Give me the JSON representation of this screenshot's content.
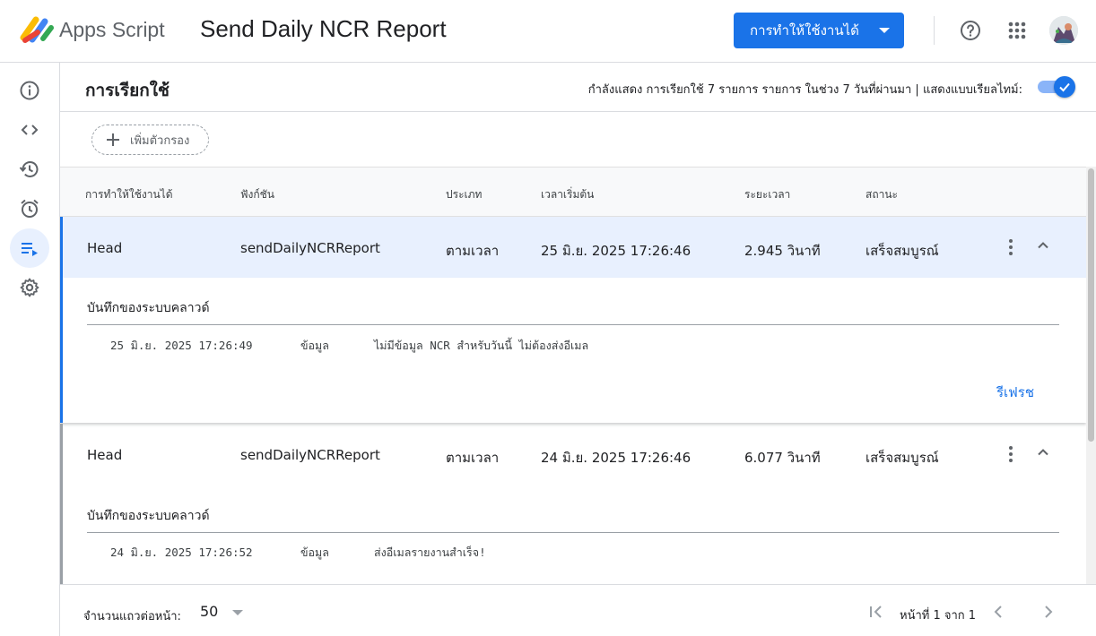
{
  "app": {
    "brand": "Apps Script",
    "project_title": "Send Daily NCR Report"
  },
  "topbar": {
    "deploy_label": "การทำให้ใช้งานได้"
  },
  "nav": {
    "items": [
      {
        "icon": "info-icon"
      },
      {
        "icon": "code-icon"
      },
      {
        "icon": "history-icon"
      },
      {
        "icon": "alarm-icon"
      },
      {
        "icon": "executions-icon",
        "active": true
      },
      {
        "icon": "gear-icon"
      }
    ]
  },
  "header": {
    "title": "การเรียกใช้",
    "summary": "กำลังแสดง การเรียกใช้ 7 รายการ รายการ ในช่วง 7 วันที่ผ่านมา  |  แสดงแบบเรียลไทม์:",
    "realtime_on": true
  },
  "filter": {
    "add_label": "เพิ่มตัวกรอง"
  },
  "table": {
    "columns": [
      "การทำให้ใช้งานได้",
      "ฟังก์ชัน",
      "ประเภท",
      "เวลาเริ่มต้น",
      "ระยะเวลา",
      "สถานะ"
    ],
    "rows": [
      {
        "deployment": "Head",
        "function": "sendDailyNCRReport",
        "type": "ตามเวลา",
        "start": "25 มิ.ย. 2025 17:26:46",
        "duration": "2.945 วินาที",
        "status": "เสร็จสมบูรณ์",
        "log_title": "บันทึกของระบบคลาวด์",
        "log": {
          "time": "25 มิ.ย. 2025 17:26:49",
          "level": "ข้อมูล",
          "message": "ไม่มีข้อมูล NCR สำหรับวันนี้ ไม่ต้องส่งอีเมล"
        },
        "refresh_label": "รีเฟรช"
      },
      {
        "deployment": "Head",
        "function": "sendDailyNCRReport",
        "type": "ตามเวลา",
        "start": "24 มิ.ย. 2025 17:26:46",
        "duration": "6.077 วินาที",
        "status": "เสร็จสมบูรณ์",
        "log_title": "บันทึกของระบบคลาวด์",
        "log": {
          "time": "24 มิ.ย. 2025 17:26:52",
          "level": "ข้อมูล",
          "message": "ส่งอีเมลรายงานสำเร็จ!"
        }
      }
    ]
  },
  "footer": {
    "rows_per_page_label": "จำนวนแถวต่อหน้า:",
    "rows_per_page": "50",
    "page_info": "หน้าที่ 1 จาก 1"
  },
  "colors": {
    "accent": "#1a73e8",
    "selected_row": "#e8f0fe"
  }
}
